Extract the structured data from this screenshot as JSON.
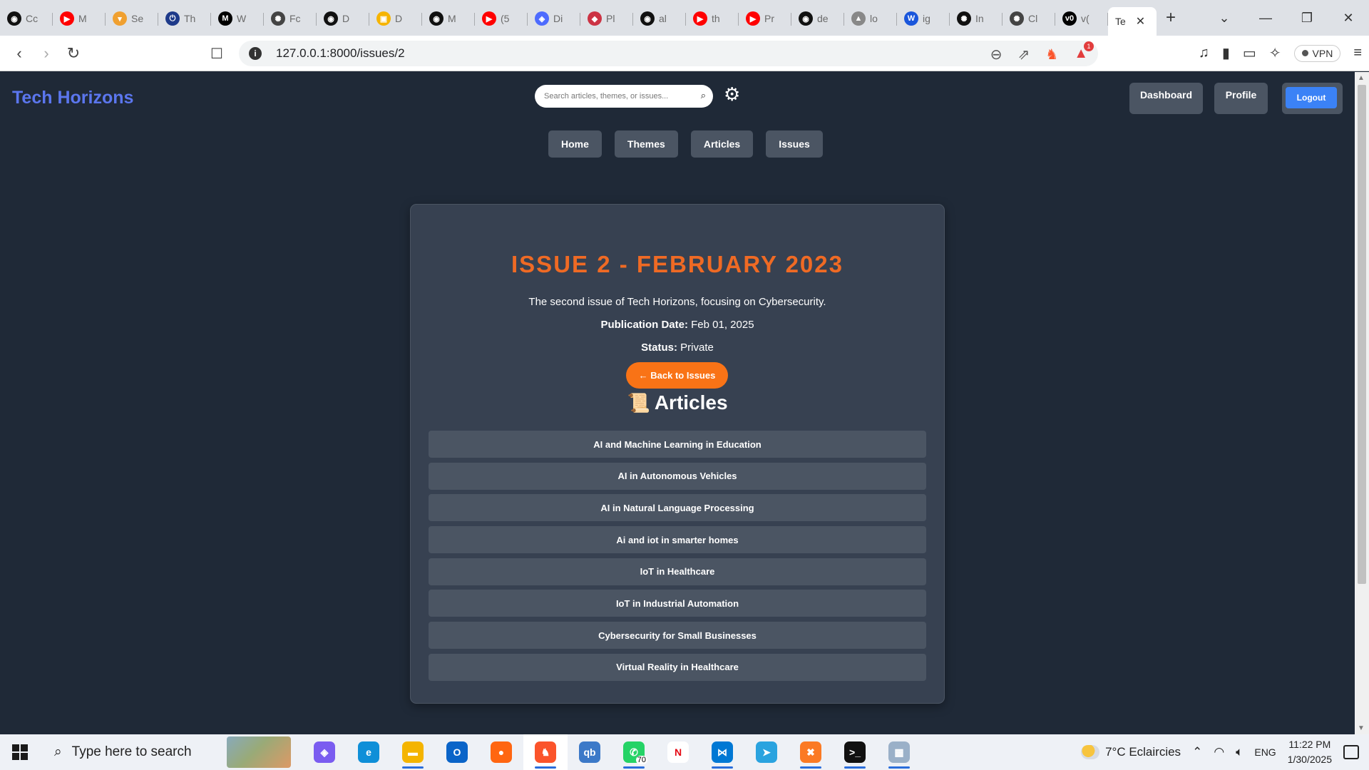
{
  "browser": {
    "tabs": [
      {
        "label": "Cc",
        "icon": "github-icon",
        "color": "#111111",
        "glyph": "◉"
      },
      {
        "label": "M",
        "icon": "youtube-icon",
        "color": "#ff0000",
        "glyph": "▶"
      },
      {
        "label": "Se",
        "icon": "seo-icon",
        "color": "#f0a030",
        "glyph": "▾"
      },
      {
        "label": "Th",
        "icon": "power-icon",
        "color": "#1e3a8a",
        "glyph": "⏻"
      },
      {
        "label": "W",
        "icon": "medium-icon",
        "color": "#000000",
        "glyph": "M"
      },
      {
        "label": "Fc",
        "icon": "openai-icon",
        "color": "#444444",
        "glyph": "✺"
      },
      {
        "label": "D",
        "icon": "github-icon",
        "color": "#111111",
        "glyph": "◉"
      },
      {
        "label": "D",
        "icon": "classroom-icon",
        "color": "#f6b400",
        "glyph": "▣"
      },
      {
        "label": "M",
        "icon": "github-icon",
        "color": "#111111",
        "glyph": "◉"
      },
      {
        "label": "(5",
        "icon": "youtube-icon",
        "color": "#ff0000",
        "glyph": "▶"
      },
      {
        "label": "Di",
        "icon": "deepseek-icon",
        "color": "#4d6bfe",
        "glyph": "◈"
      },
      {
        "label": "Pl",
        "icon": "plex-icon",
        "color": "#cc3344",
        "glyph": "◆"
      },
      {
        "label": "al",
        "icon": "github-icon",
        "color": "#111111",
        "glyph": "◉"
      },
      {
        "label": "th",
        "icon": "youtube-icon",
        "color": "#ff0000",
        "glyph": "▶"
      },
      {
        "label": "Pr",
        "icon": "youtube-icon",
        "color": "#ff0000",
        "glyph": "▶"
      },
      {
        "label": "de",
        "icon": "github-icon",
        "color": "#111111",
        "glyph": "◉"
      },
      {
        "label": "lo",
        "icon": "mountain-icon",
        "color": "#888888",
        "glyph": "▲"
      },
      {
        "label": "ig",
        "icon": "wikipedia-icon",
        "color": "#1a56db",
        "glyph": "W"
      },
      {
        "label": "In",
        "icon": "chatgpt-icon",
        "color": "#111111",
        "glyph": "✺"
      },
      {
        "label": "Cl",
        "icon": "openai-icon",
        "color": "#444444",
        "glyph": "✺"
      },
      {
        "label": "v(",
        "icon": "v0-icon",
        "color": "#000000",
        "glyph": "v0"
      }
    ],
    "active_tab": {
      "label": "Te",
      "close": "✕"
    },
    "new_tab": "+",
    "window_controls": {
      "tabsearch": "⌄",
      "minimize": "—",
      "restore": "❐",
      "close": "✕"
    },
    "url": "127.0.0.1:8000/issues/2",
    "notification_count": "1",
    "vpn_label": "VPN"
  },
  "site": {
    "brand": "Tech Horizons",
    "search_placeholder": "Search articles, themes, or issues...",
    "header_buttons": {
      "dashboard": "Dashboard",
      "profile": "Profile",
      "logout": "Logout"
    },
    "nav": [
      "Home",
      "Themes",
      "Articles",
      "Issues"
    ]
  },
  "issue": {
    "title": "ISSUE 2 - FEBRUARY 2023",
    "description": "The second issue of Tech Horizons, focusing on Cybersecurity.",
    "publication_label": "Publication Date:",
    "publication_date": "Feb 01, 2025",
    "status_label": "Status:",
    "status": "Private",
    "back_button": "← Back to Issues",
    "articles_heading": "Articles",
    "articles_emoji": "📜",
    "articles": [
      "AI and Machine Learning in Education",
      "AI in Autonomous Vehicles",
      "AI in Natural Language Processing",
      "Ai and iot in smarter homes",
      "IoT in Healthcare",
      "IoT in Industrial Automation",
      "Cybersecurity for Small Businesses",
      "Virtual Reality in Healthcare"
    ]
  },
  "taskbar": {
    "search_placeholder": "Type here to search",
    "apps": [
      {
        "name": "copilot-icon",
        "color": "#7a5cf0",
        "glyph": "◈",
        "running": false
      },
      {
        "name": "edge-icon",
        "color": "#0f8fd8",
        "glyph": "e",
        "running": false
      },
      {
        "name": "file-explorer-icon",
        "color": "#f4b400",
        "glyph": "▬",
        "running": true
      },
      {
        "name": "outlook-icon",
        "color": "#0a64c8",
        "glyph": "O",
        "running": false
      },
      {
        "name": "firefox-icon",
        "color": "#ff6611",
        "glyph": "●",
        "running": false
      },
      {
        "name": "brave-icon",
        "color": "#fb542b",
        "glyph": "♞",
        "running": true,
        "active": true
      },
      {
        "name": "qbittorrent-icon",
        "color": "#3c79c8",
        "glyph": "qb",
        "running": false
      },
      {
        "name": "whatsapp-icon",
        "color": "#25d366",
        "glyph": "✆",
        "running": true,
        "badge": "70"
      },
      {
        "name": "netflix-icon",
        "color": "#ffffff",
        "glyph": "N",
        "fg": "#e50914",
        "running": false
      },
      {
        "name": "vscode-icon",
        "color": "#0078d4",
        "glyph": "⋈",
        "running": true
      },
      {
        "name": "telegram-icon",
        "color": "#2aa3df",
        "glyph": "➤",
        "running": false
      },
      {
        "name": "xampp-icon",
        "color": "#fb7a24",
        "glyph": "✖",
        "running": true
      },
      {
        "name": "terminal-icon",
        "color": "#111111",
        "glyph": ">_",
        "running": true
      },
      {
        "name": "photos-icon",
        "color": "#9ab0c8",
        "glyph": "▦",
        "running": true
      }
    ],
    "weather": "7°C  Eclaircies",
    "language": "ENG",
    "time": "11:22 PM",
    "date": "1/30/2025"
  }
}
